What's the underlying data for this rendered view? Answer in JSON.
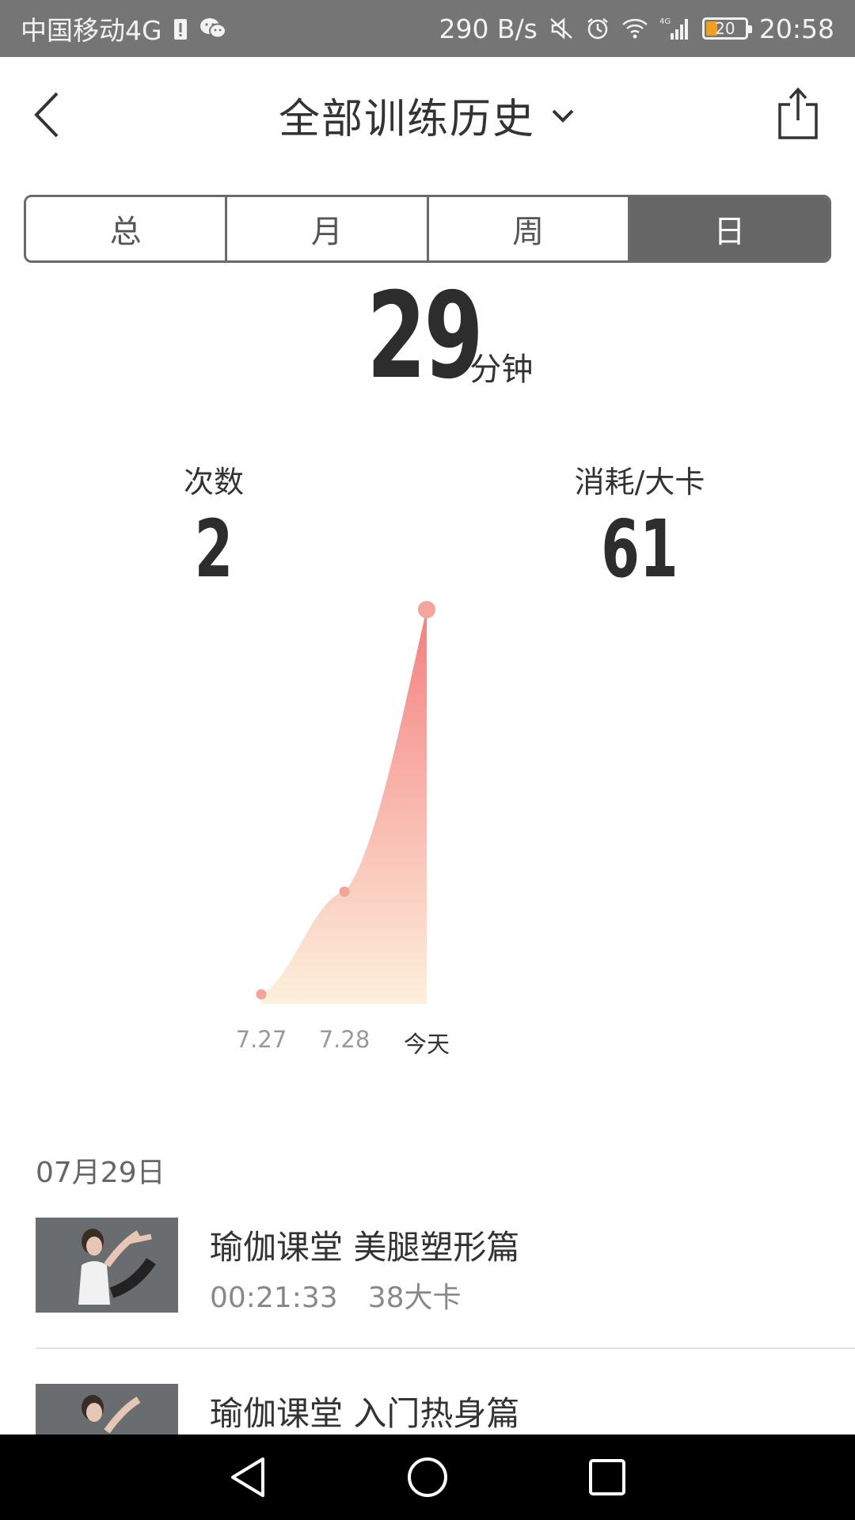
{
  "status_bar": {
    "carrier": "中国移动4G",
    "net_speed": "290 B/s",
    "network": "4G",
    "battery": "20",
    "time": "20:58",
    "battery_color": "#f0a020"
  },
  "header": {
    "title": "全部训练历史",
    "icons": {
      "back": "back-arrow-icon",
      "dropdown": "chevron-down-icon",
      "share": "share-icon"
    }
  },
  "tabs": [
    {
      "label": "总",
      "active": false
    },
    {
      "label": "月",
      "active": false
    },
    {
      "label": "周",
      "active": false
    },
    {
      "label": "日",
      "active": true
    }
  ],
  "summary": {
    "duration_value": "29",
    "duration_unit": "分钟",
    "count_label": "次数",
    "count_value": "2",
    "calories_label": "消耗/大卡",
    "calories_value": "61"
  },
  "chart_data": {
    "type": "area",
    "categories": [
      "7.27",
      "7.28",
      "今天"
    ],
    "values": [
      0,
      8,
      29
    ],
    "ylim": [
      0,
      29
    ],
    "grid": false,
    "colors": {
      "top": "#f47f7f",
      "bottom": "#fdf0dc",
      "point": "#f4a49a"
    }
  },
  "history": {
    "date": "07月29日",
    "items": [
      {
        "title": "瑜伽课堂  美腿塑形篇",
        "duration": "00:21:33",
        "calories": "38大卡"
      },
      {
        "title": "瑜伽课堂  入门热身篇",
        "duration": "",
        "calories": ""
      }
    ]
  }
}
